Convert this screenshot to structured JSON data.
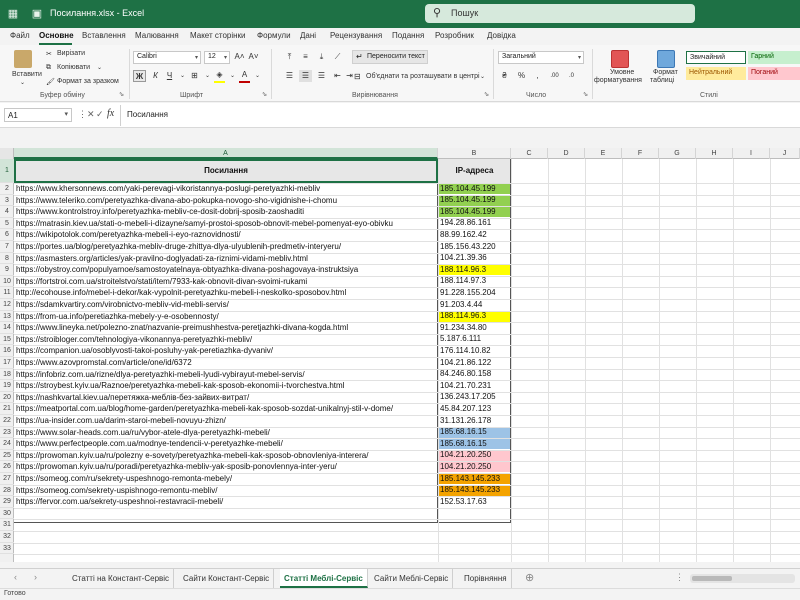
{
  "window": {
    "title": "Посилання.xlsx  -  Excel",
    "search_placeholder": "Пошук"
  },
  "menu": {
    "tabs": [
      "Файл",
      "Основне",
      "Вставлення",
      "Малювання",
      "Макет сторінки",
      "Формули",
      "Дані",
      "Рецензування",
      "Подання",
      "Розробник",
      "Довідка"
    ],
    "active_index": 1
  },
  "ribbon": {
    "paste_label": "Вставити",
    "cut_label": "Вирізати",
    "copy_label": "Копіювати",
    "format_painter_label": "Формат за зразком",
    "clipboard_group": "Буфер обміну",
    "font_name": "Calibri",
    "font_size": "12",
    "font_group": "Шрифт",
    "wrap_text": "Переносити текст",
    "merge_center": "Об'єднати та розташувати в центрі",
    "alignment_group": "Вирівнювання",
    "number_format": "Загальний",
    "number_group": "Число",
    "cond_format_line1": "Умовне",
    "cond_format_line2": "форматування",
    "format_table_line1": "Формат",
    "format_table_line2": "таблиці",
    "styles_group": "Стилі",
    "style_normal": "Звичайний",
    "style_good": "Гарний",
    "style_neutral": "Нейтральний",
    "style_bad": "Поганий",
    "font_color": "#c00000",
    "fill_color": "#ffff00"
  },
  "formula_bar": {
    "name_box": "A1",
    "content": "Посилання"
  },
  "columns": [
    "A",
    "B",
    "C",
    "D",
    "E",
    "F",
    "G",
    "H",
    "I",
    "J"
  ],
  "sheet": {
    "header_link": "Посилання",
    "header_ip": "IP-адреса",
    "rows": [
      {
        "link": "https://www.khersonnews.com/yaki-perevagi-vikoristannya-poslugi-peretyazhki-mebliv",
        "ip": "185.104.45.199",
        "color": "#92d050"
      },
      {
        "link": "https://www.teleriko.com/peretyazhka-divana-abo-pokupka-novogo-sho-vigidnishe-i-chomu",
        "ip": "185.104.45.199",
        "color": "#92d050"
      },
      {
        "link": "https://www.kontrolstroy.info/peretyazhka-mebliv-ce-dosit-dobrij-sposib-zaoshaditi",
        "ip": "185.104.45.199",
        "color": "#92d050"
      },
      {
        "link": "https://matrasin.kiev.ua/stati-o-mebeli-i-dizayne/samyi-prostoi-sposob-obnovit-mebel-pomenyat-eyo-obivku",
        "ip": "194.28.86.161",
        "color": ""
      },
      {
        "link": "https://wikipotolok.com/peretyazhka-mebeli-i-eyo-raznovidnosti/",
        "ip": "88.99.162.42",
        "color": ""
      },
      {
        "link": "https://portes.ua/blog/peretyazhka-mebliv-druge-zhittya-dlya-ulyublenih-predmetiv-interyeru/",
        "ip": "185.156.43.220",
        "color": ""
      },
      {
        "link": "https://asmasters.org/articles/yak-pravilno-doglyadati-za-riznimi-vidami-mebliv.html",
        "ip": "104.21.39.36",
        "color": ""
      },
      {
        "link": "https://obystroy.com/populyarnoe/samostoyatelnaya-obtyazhka-divana-poshagovaya-instruktsiya",
        "ip": "188.114.96.3",
        "color": "#ffff00"
      },
      {
        "link": "https://fortstroi.com.ua/stroitelstvo/stati/item/7933-kak-obnovit-divan-svoimi-rukami",
        "ip": "188.114.97.3",
        "color": ""
      },
      {
        "link": "http://ecohouse.info/mebel-i-dekor/kak-vypolnit-peretyazhku-mebeli-i-neskolko-sposobov.html",
        "ip": "91.228.155.204",
        "color": ""
      },
      {
        "link": "https://sdamkvartiry.com/virobnictvo-mebliv-vid-mebli-servis/",
        "ip": "91.203.4.44",
        "color": ""
      },
      {
        "link": "https://from-ua.info/peretiazhka-mebely-y-e-osobennosty/",
        "ip": "188.114.96.3",
        "color": "#ffff00"
      },
      {
        "link": "https://www.lineyka.net/polezno-znat/nazvanie-preimushhestva-peretjazhki-divana-kogda.html",
        "ip": "91.234.34.80",
        "color": ""
      },
      {
        "link": "https://stroibloger.com/tehnologiya-vikonannya-peretyazhki-mebliv/",
        "ip": "5.187.6.111",
        "color": ""
      },
      {
        "link": "https://companion.ua/osoblyvosti-takoi-posluhy-yak-peretiazhka-dyvaniv/",
        "ip": "176.114.10.82",
        "color": ""
      },
      {
        "link": "https://www.azovpromstal.com/article/one/id/6372",
        "ip": "104.21.86.122",
        "color": ""
      },
      {
        "link": "https://infobriz.com.ua/rizne/dlya-peretyazhki-mebeli-lyudi-vybirayut-mebel-servis/",
        "ip": "84.246.80.158",
        "color": ""
      },
      {
        "link": "https://stroybest.kyiv.ua/Raznoe/peretyazhka-mebeli-kak-sposob-ekonomii-i-tvorchestva.html",
        "ip": "104.21.70.231",
        "color": ""
      },
      {
        "link": "https://nashkvartal.kiev.ua/перетяжка-меблів-без-зайвих-витрат/",
        "ip": "136.243.17.205",
        "color": ""
      },
      {
        "link": "https://meatportal.com.ua/blog/home-garden/peretyazhka-mebeli-kak-sposob-sozdat-unikalnyj-stil-v-dome/",
        "ip": "45.84.207.123",
        "color": ""
      },
      {
        "link": "https://ua-insider.com.ua/darim-staroi-mebeli-novuyu-zhizn/",
        "ip": "31.131.26.178",
        "color": ""
      },
      {
        "link": "https://www.solar-heads.com.ua/ru/vybor-atele-dlya-peretyazhki-mebeli/",
        "ip": "185.68.16.15",
        "color": "#9dc3e6"
      },
      {
        "link": "https://www.perfectpeople.com.ua/modnye-tendencii-v-peretyazhke-mebeli/",
        "ip": "185.68.16.15",
        "color": "#9dc3e6"
      },
      {
        "link": "https://prowoman.kyiv.ua/ru/polezny e-sovety/peretyazhka-mebeli-kak-sposob-obnovleniya-interera/",
        "ip": "104.21.20.250",
        "color": "#ffc7ce"
      },
      {
        "link": "https://prowoman.kyiv.ua/ru/poradi/peretyazhka-mebliv-yak-sposib-ponovlennya-inter-yeru/",
        "ip": "104.21.20.250",
        "color": "#ffc7ce"
      },
      {
        "link": "https://someog.com/ru/sekrety-uspeshnogo-remonta-mebely/",
        "ip": "185.143.145.233",
        "color": "#f4a300"
      },
      {
        "link": "https://someog.com/sekrety-uspishnogo-remontu-mebliv/",
        "ip": "185.143.145.233",
        "color": "#f4a300"
      },
      {
        "link": "https://fervor.com.ua/sekrety-uspeshnoi-restavracii-mebeli/",
        "ip": "152.53.17.63",
        "color": ""
      }
    ]
  },
  "sheet_tabs": [
    "Статті на Констант-Сервіс",
    "Сайти Констант-Сервіс",
    "Статті Меблі-Сервіс",
    "Сайти Меблі-Сервіс",
    "Порівняння"
  ],
  "active_sheet_index": 2,
  "status": {
    "text": "Готово"
  }
}
